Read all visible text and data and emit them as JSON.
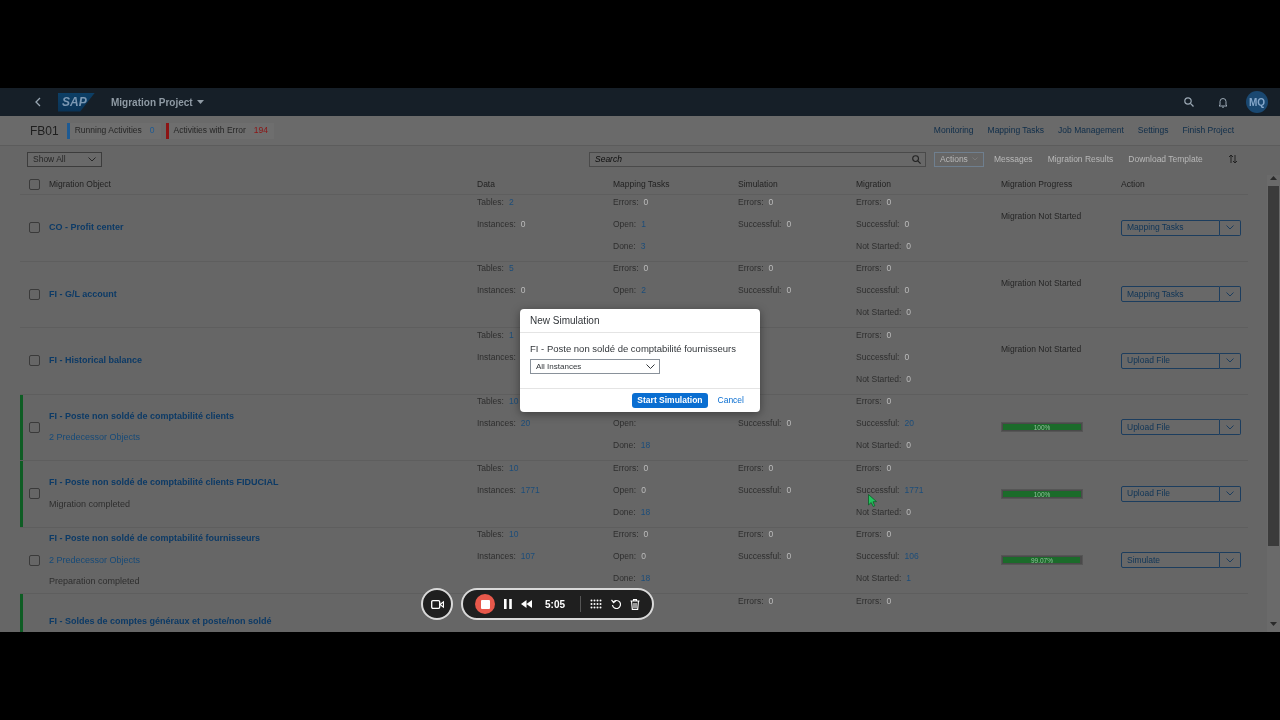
{
  "shell": {
    "logo": "SAP",
    "title": "Migration Project",
    "avatar": "MQ"
  },
  "header": {
    "project": "FB01",
    "indicators": [
      {
        "label": "Running Activities",
        "count": "0",
        "color": "#1d5a93"
      },
      {
        "label": "Activities with Error",
        "count": "194",
        "color": "#8c1414"
      }
    ],
    "links": [
      "Monitoring",
      "Mapping Tasks",
      "Job Management",
      "Settings",
      "Finish Project"
    ]
  },
  "toolbar": {
    "filter": "Show All",
    "search": {
      "placeholder": "Search"
    },
    "buttons": [
      {
        "label": "Actions",
        "kind": "menu",
        "disabled": true
      },
      {
        "label": "Messages",
        "kind": "plain",
        "disabled": true
      },
      {
        "label": "Migration Results",
        "kind": "plain",
        "disabled": true
      },
      {
        "label": "Download Template",
        "kind": "plain",
        "disabled": true
      }
    ]
  },
  "table": {
    "select_all": {
      "checked": false
    },
    "columns": [
      "Migration Object",
      "Data",
      "Mapping Tasks",
      "Simulation",
      "Migration",
      "Migration Progress",
      "Action"
    ],
    "rows": [
      {
        "title": "CO - Profit center",
        "checked": false,
        "highlighted": false,
        "sublines": [],
        "data": {
          "tables": {
            "label": "Tables:",
            "value": "2",
            "linked": true
          },
          "instances": {
            "label": "Instances:",
            "value": "0",
            "linked": false
          }
        },
        "mapping": {
          "errors": {
            "label": "Errors:",
            "value": "0",
            "linked": false
          },
          "open": {
            "label": "Open:",
            "value": "1",
            "linked": true
          },
          "done": {
            "label": "Done:",
            "value": "3",
            "linked": true
          }
        },
        "simulation": {
          "errors": {
            "label": "Errors:",
            "value": "0",
            "linked": false
          },
          "successful": {
            "label": "Successful:",
            "value": "0",
            "linked": false
          }
        },
        "migration": {
          "errors": {
            "label": "Errors:",
            "value": "0",
            "linked": false
          },
          "successful": {
            "label": "Successful:",
            "value": "0",
            "linked": false
          },
          "not_started": {
            "label": "Not Started:",
            "value": "0",
            "linked": false
          }
        },
        "progress": {
          "status": "Migration Not Started"
        },
        "action": "Mapping Tasks"
      },
      {
        "title": "FI - G/L account",
        "checked": false,
        "highlighted": false,
        "sublines": [],
        "data": {
          "tables": {
            "label": "Tables:",
            "value": "5",
            "linked": true
          },
          "instances": {
            "label": "Instances:",
            "value": "0",
            "linked": false
          }
        },
        "mapping": {
          "errors": {
            "label": "Errors:",
            "value": "0",
            "linked": false
          },
          "open": {
            "label": "Open:",
            "value": "2",
            "linked": true
          }
        },
        "simulation": {
          "errors": {
            "label": "Errors:",
            "value": "0",
            "linked": false
          },
          "successful": {
            "label": "Successful:",
            "value": "0",
            "linked": false
          }
        },
        "migration": {
          "errors": {
            "label": "Errors:",
            "value": "0",
            "linked": false
          },
          "successful": {
            "label": "Successful:",
            "value": "0",
            "linked": false
          },
          "not_started": {
            "label": "Not Started:",
            "value": "0",
            "linked": false
          }
        },
        "progress": {
          "status": "Migration Not Started"
        },
        "action": "Mapping Tasks"
      },
      {
        "title": "FI - Historical balance",
        "checked": false,
        "highlighted": false,
        "sublines": [],
        "data": {
          "tables": {
            "label": "Tables:",
            "value": "1",
            "linked": true
          },
          "instances": {
            "label": "Instances:"
          }
        },
        "mapping": {},
        "simulation": {},
        "migration": {
          "errors": {
            "label": "Errors:",
            "value": "0",
            "linked": false
          },
          "successful": {
            "label": "Successful:",
            "value": "0",
            "linked": false
          },
          "not_started": {
            "label": "Not Started:",
            "value": "0",
            "linked": false
          }
        },
        "progress": {
          "status": "Migration Not Started"
        },
        "action": "Upload File"
      },
      {
        "title": "FI - Poste non soldé de comptabilité clients",
        "checked": false,
        "highlighted": true,
        "sublines": [
          {
            "text": "2 Predecessor Objects",
            "kind": "link"
          }
        ],
        "data": {
          "tables": {
            "label": "Tables:",
            "value": "10",
            "linked": true
          },
          "instances": {
            "label": "Instances:",
            "value": "20",
            "linked": true
          }
        },
        "mapping": {
          "open": {
            "label": "Open:"
          },
          "done": {
            "label": "Done:",
            "value": "18",
            "linked": true
          }
        },
        "simulation": {
          "successful": {
            "label": "Successful:",
            "value": "0",
            "linked": false
          }
        },
        "migration": {
          "errors": {
            "label": "Errors:",
            "value": "0",
            "linked": false
          },
          "successful": {
            "label": "Successful:",
            "value": "20",
            "linked": true
          },
          "not_started": {
            "label": "Not Started:",
            "value": "0",
            "linked": false
          }
        },
        "progress": {
          "level": 1,
          "label": "100%"
        },
        "action": "Upload File"
      },
      {
        "title": "FI - Poste non soldé de comptabilité clients FIDUCIAL",
        "checked": false,
        "highlighted": true,
        "sublines": [
          {
            "text": "Migration completed",
            "kind": "status"
          }
        ],
        "data": {
          "tables": {
            "label": "Tables:",
            "value": "10",
            "linked": true
          },
          "instances": {
            "label": "Instances:",
            "value": "1771",
            "linked": true
          }
        },
        "mapping": {
          "errors": {
            "label": "Errors:",
            "value": "0",
            "linked": false
          },
          "open": {
            "label": "Open:",
            "value": "0",
            "linked": false
          },
          "done": {
            "label": "Done:",
            "value": "18",
            "linked": true
          }
        },
        "simulation": {
          "errors": {
            "label": "Errors:",
            "value": "0",
            "linked": false
          },
          "successful": {
            "label": "Successful:",
            "value": "0",
            "linked": false
          }
        },
        "migration": {
          "errors": {
            "label": "Errors:",
            "value": "0",
            "linked": false
          },
          "successful": {
            "label": "Successful:",
            "value": "1771",
            "linked": true
          },
          "not_started": {
            "label": "Not Started:",
            "value": "0",
            "linked": false
          }
        },
        "progress": {
          "level": 1,
          "label": "100%"
        },
        "action": "Upload File"
      },
      {
        "title": "FI - Poste non soldé de comptabilité fournisseurs",
        "checked": false,
        "highlighted": false,
        "sublines": [
          {
            "text": "2 Predecessor Objects",
            "kind": "link"
          },
          {
            "text": "Preparation completed",
            "kind": "status"
          }
        ],
        "data": {
          "tables": {
            "label": "Tables:",
            "value": "10",
            "linked": true
          },
          "instances": {
            "label": "Instances:",
            "value": "107",
            "linked": true
          }
        },
        "mapping": {
          "errors": {
            "label": "Errors:",
            "value": "0",
            "linked": false
          },
          "open": {
            "label": "Open:",
            "value": "0",
            "linked": false
          },
          "done": {
            "label": "Done:",
            "value": "18",
            "linked": true
          }
        },
        "simulation": {
          "errors": {
            "label": "Errors:",
            "value": "0",
            "linked": false
          },
          "successful": {
            "label": "Successful:",
            "value": "0",
            "linked": false
          }
        },
        "migration": {
          "errors": {
            "label": "Errors:",
            "value": "0",
            "linked": false
          },
          "successful": {
            "label": "Successful:",
            "value": "106",
            "linked": true
          },
          "not_started": {
            "label": "Not Started:",
            "value": "1",
            "linked": true
          }
        },
        "progress": {
          "level": 0.9907,
          "label": "99.07%"
        },
        "action": "Simulate"
      },
      {
        "title": "FI - Soldes de comptes généraux et poste/non soldé",
        "highlighted": true,
        "sublines": [],
        "data": {},
        "mapping": {},
        "simulation": {
          "errors": {
            "label": "Errors:",
            "value": "0",
            "linked": false
          }
        },
        "migration": {
          "errors": {
            "label": "Errors:",
            "value": "0",
            "linked": false
          }
        }
      }
    ]
  },
  "dialog": {
    "title": "New Simulation",
    "object": "FI - Poste non soldé de comptabilité fournisseurs",
    "select": {
      "value": "All Instances"
    },
    "buttons": [
      {
        "label": "Start Simulation",
        "kind": "primary"
      },
      {
        "label": "Cancel",
        "kind": "link"
      }
    ]
  },
  "recorder": {
    "time": "5:05"
  }
}
